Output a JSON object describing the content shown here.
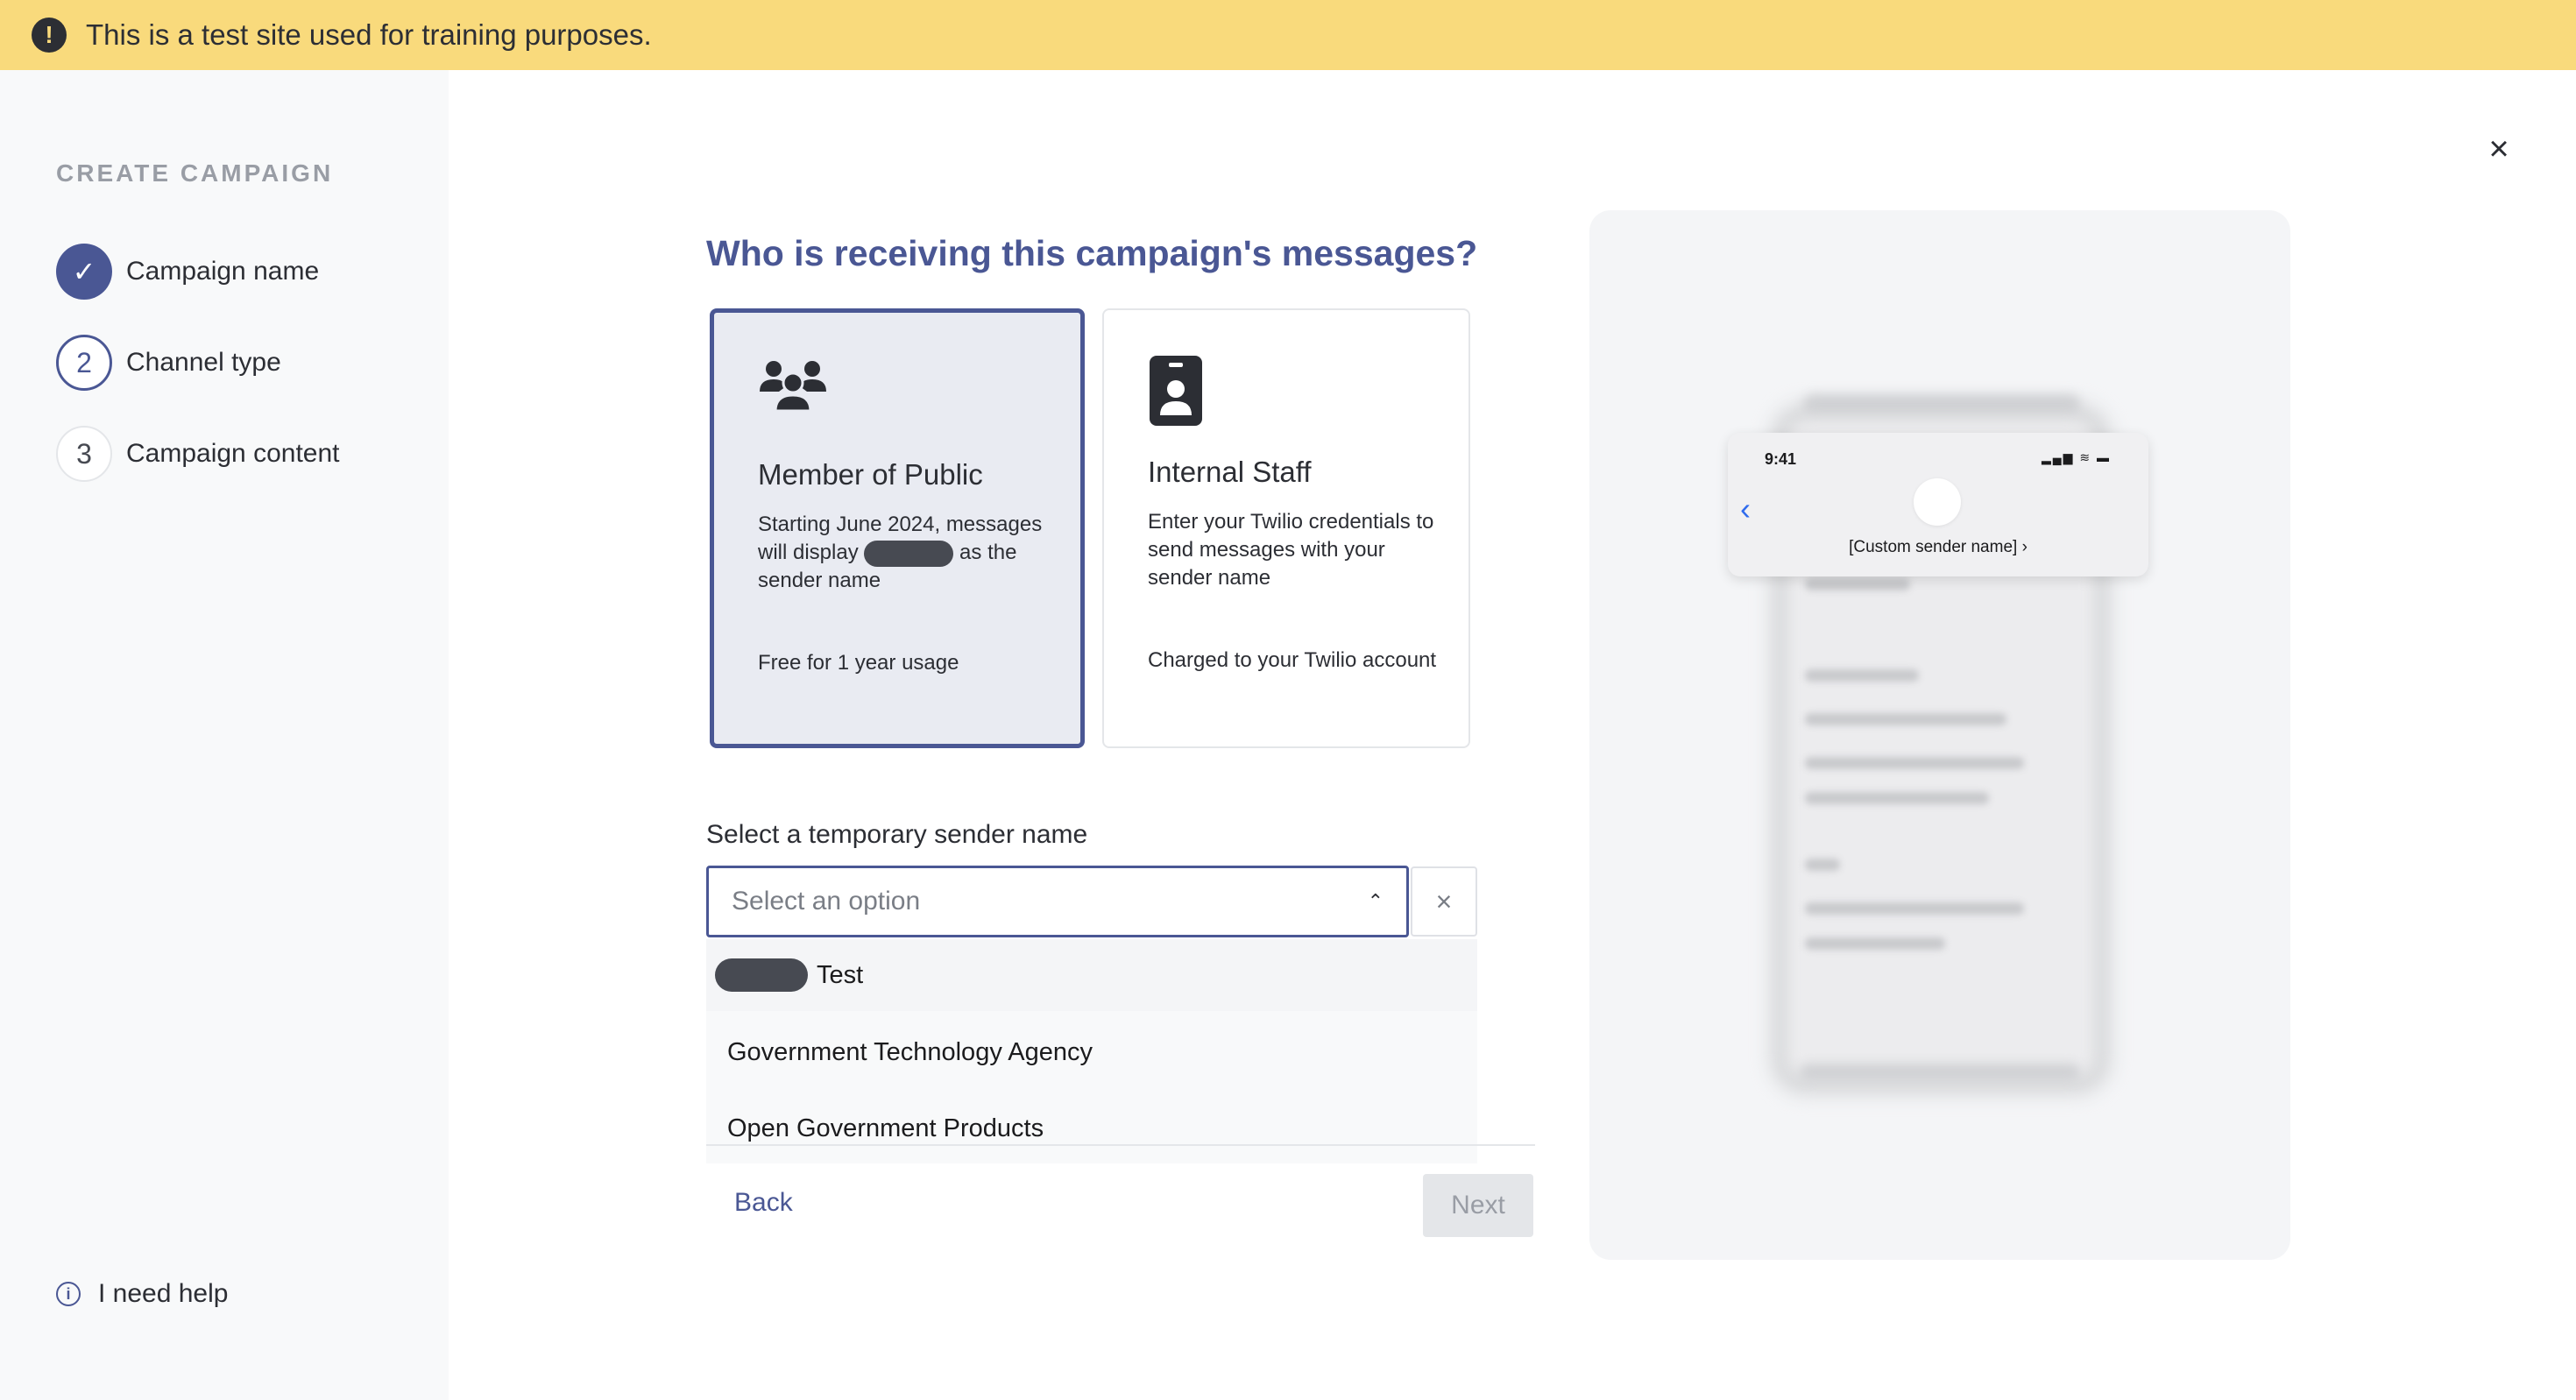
{
  "banner": {
    "text": "This is a test site used for training purposes.",
    "icon": "!"
  },
  "sidebar": {
    "title": "CREATE CAMPAIGN",
    "steps": [
      {
        "number": "✓",
        "label": "Campaign name",
        "state": "done"
      },
      {
        "number": "2",
        "label": "Channel type",
        "state": "active"
      },
      {
        "number": "3",
        "label": "Campaign content",
        "state": "todo"
      }
    ],
    "help_label": "I need help",
    "help_icon": "i"
  },
  "main": {
    "close_label": "×",
    "question": "Who is receiving this campaign's messages?",
    "cards": [
      {
        "title": "Member of Public",
        "desc_part1": "Starting June 2024, messages will display",
        "desc_part2": "as the sender name",
        "note": "Free for 1 year usage",
        "icon": "people-icon",
        "selected": true
      },
      {
        "title": "Internal Staff",
        "desc": "Enter your Twilio credentials to send messages with your sender name",
        "note": "Charged to your Twilio account",
        "icon": "id-badge-icon",
        "selected": false
      }
    ],
    "field_label": "Select a temporary sender name",
    "select_placeholder": "Select an option",
    "chevron": "⌃",
    "clear_label": "×",
    "options": [
      "Test",
      "Government Technology Agency",
      "Open Government Products"
    ],
    "back_label": "Back",
    "next_label": "Next"
  },
  "preview": {
    "time": "9:41",
    "status": "▂▄▆ ≋ ▬",
    "back": "‹",
    "sender_name": "[Custom sender name] ›"
  },
  "colors": {
    "banner": "#f9da7c",
    "accent": "#4a5794",
    "sidebar_bg": "#f8f9fa",
    "selected_card_bg": "#e9ebf2",
    "preview_bg": "#f4f5f7",
    "ios_link": "#2f6bed"
  }
}
